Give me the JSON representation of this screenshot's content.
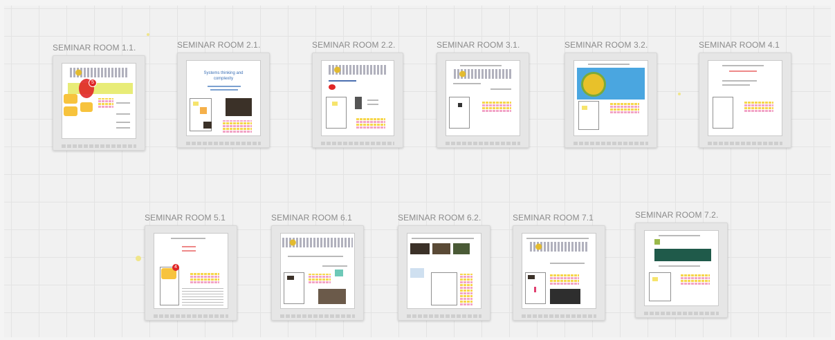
{
  "board": {
    "rooms": [
      {
        "label": "SEMINAR ROOM 1.1."
      },
      {
        "label": "SEMINAR ROOM 2.1."
      },
      {
        "label": "SEMINAR ROOM 2.2."
      },
      {
        "label": "SEMINAR ROOM 3.1."
      },
      {
        "label": "SEMINAR ROOM 3.2."
      },
      {
        "label": "SEMINAR ROOM 4.1"
      },
      {
        "label": "SEMINAR ROOM 5.1"
      },
      {
        "label": "SEMINAR ROOM 6.1"
      },
      {
        "label": "SEMINAR ROOM 6.2."
      },
      {
        "label": "SEMINAR ROOM 7.1"
      },
      {
        "label": "SEMINAR ROOM 7.2."
      }
    ],
    "room21_title": "Systems thinking and complexity",
    "colors": {
      "canvas": "#f1f1f1",
      "grid": "#e3e3e3",
      "sticky_yellow": "#f6d64b",
      "sticky_pink": "#f2a4c6",
      "accent_red": "#e02727",
      "accent_blue": "#4aa6e0",
      "accent_green": "#1f5a4a"
    },
    "icons": [
      "comment-bubble-icon",
      "notification-badge-icon"
    ],
    "badges": {
      "room11": "5",
      "room51": "4"
    }
  }
}
